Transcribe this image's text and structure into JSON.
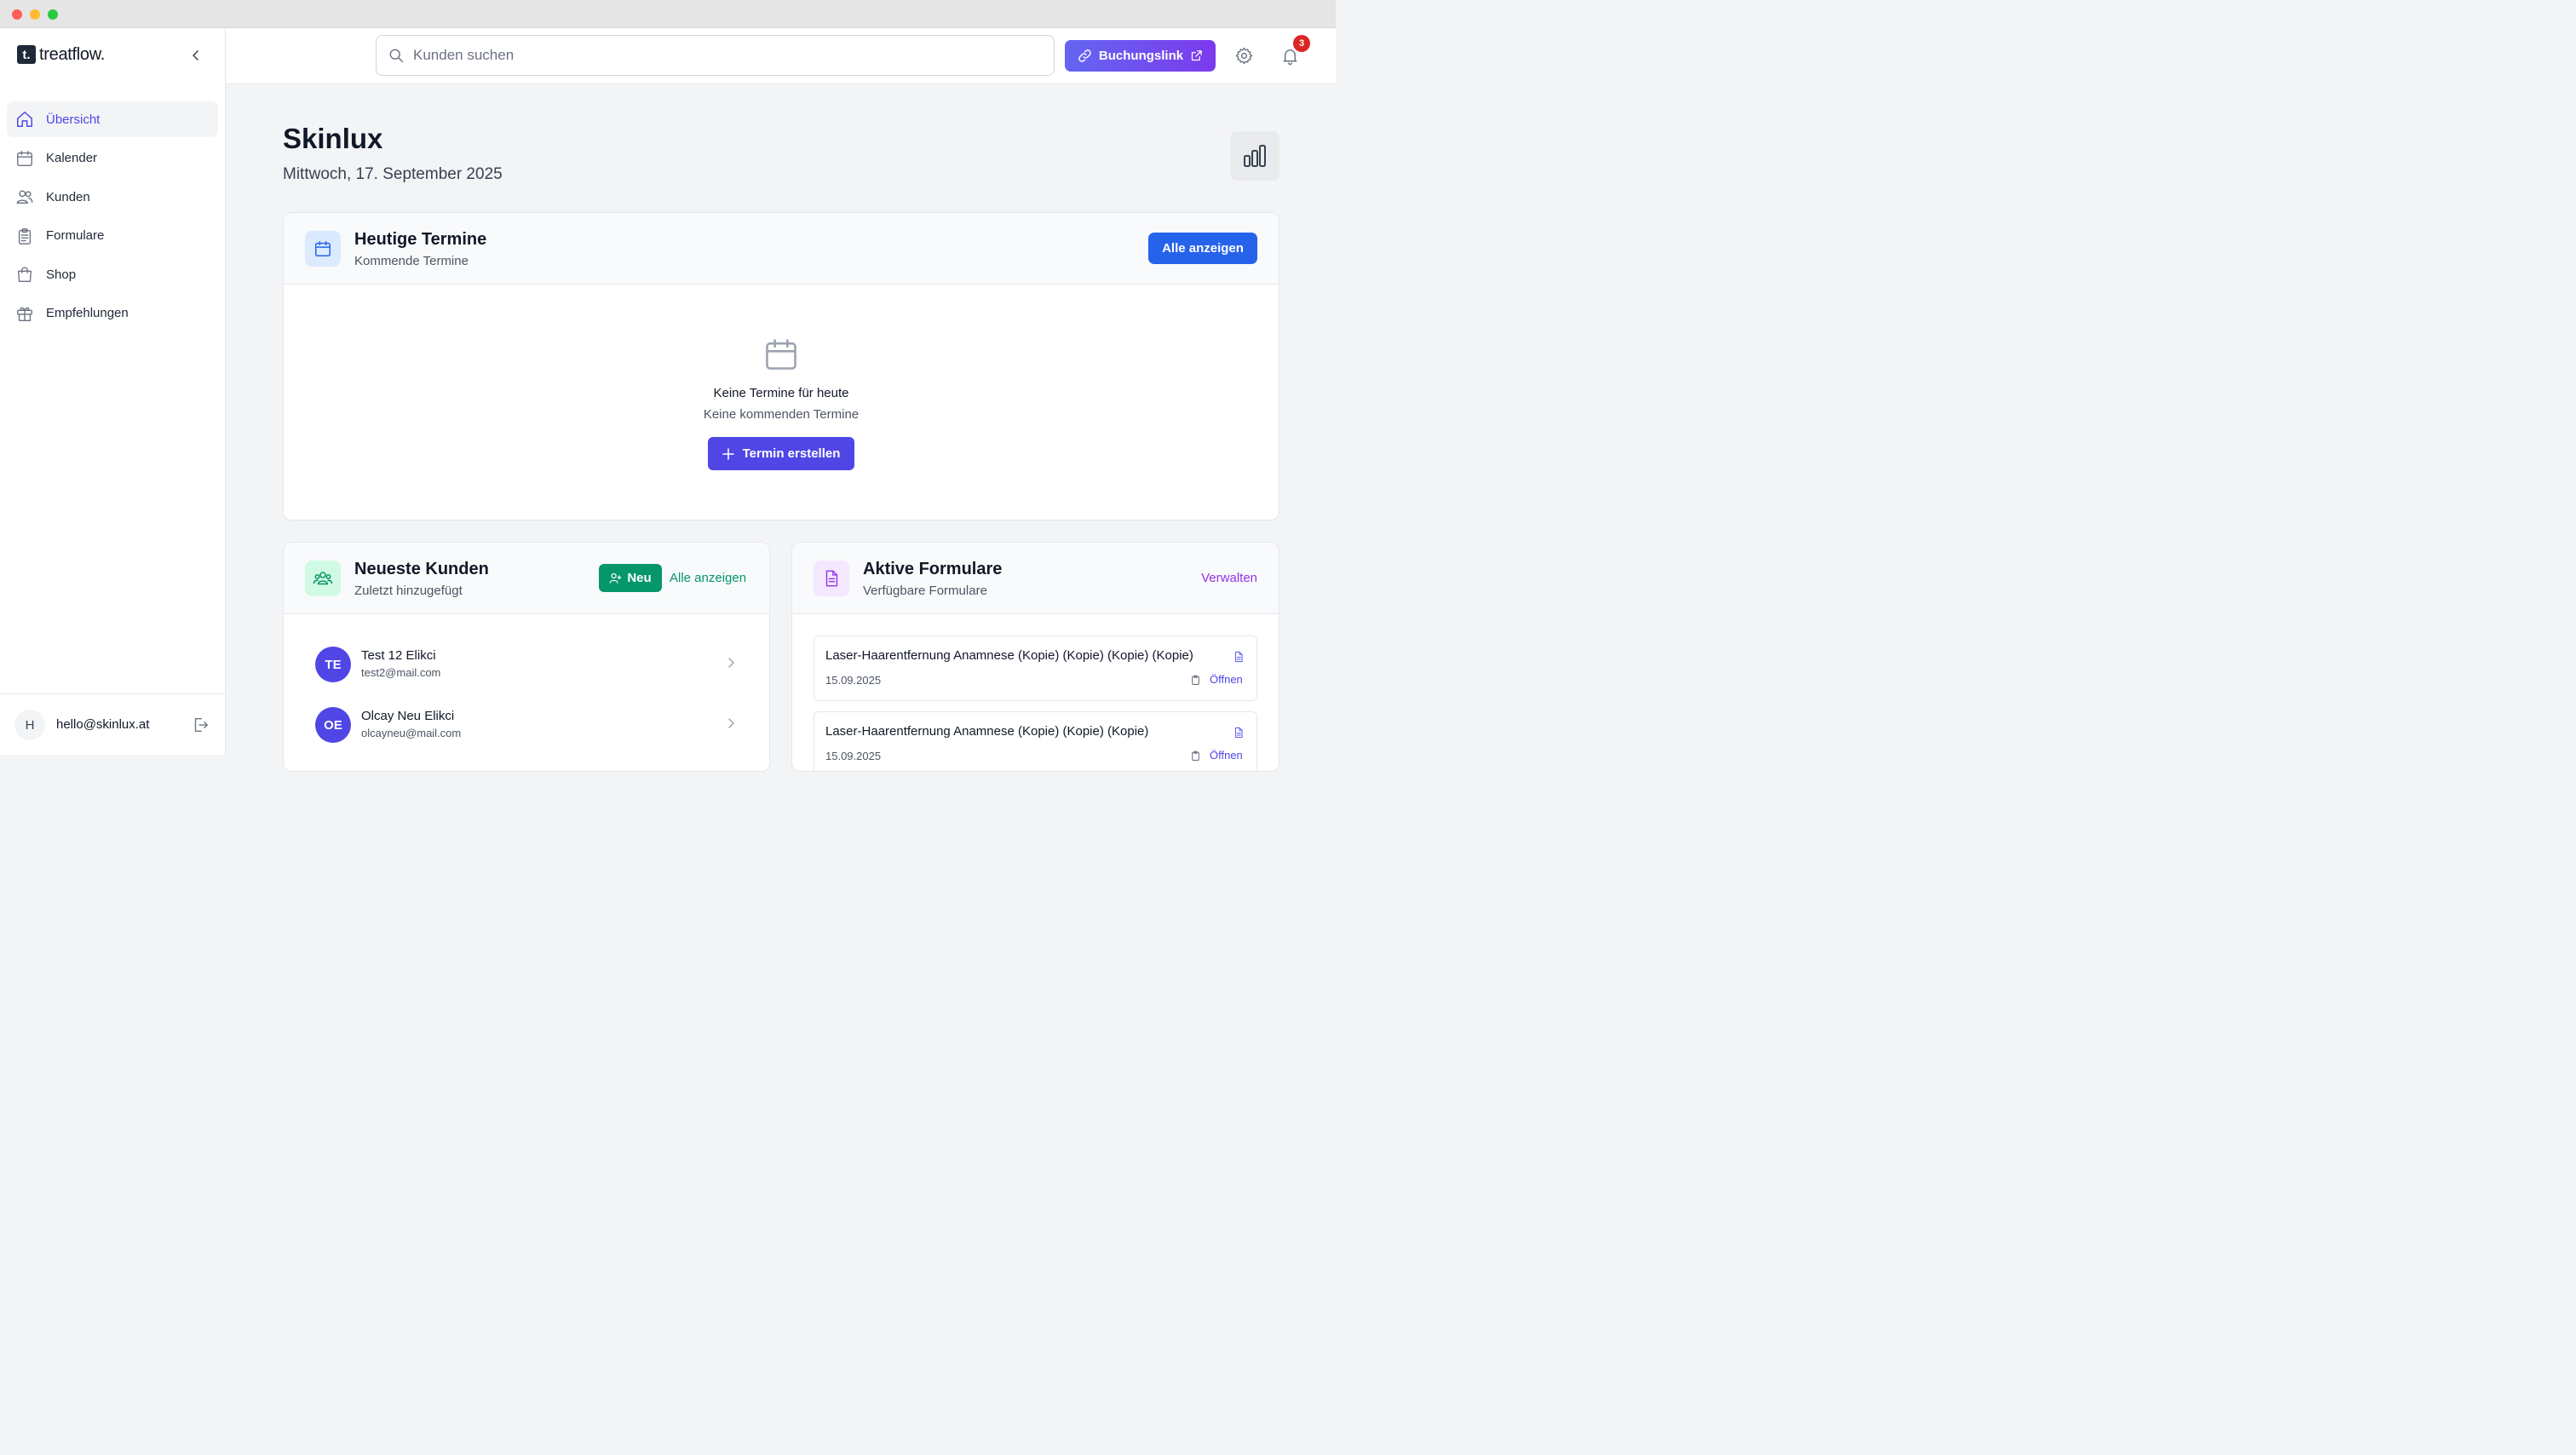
{
  "app": {
    "logo_mark": "t.",
    "logo_text": "treatflow."
  },
  "sidebar": {
    "items": [
      {
        "label": "Übersicht",
        "icon": "home-icon",
        "active": true
      },
      {
        "label": "Kalender",
        "icon": "calendar-icon",
        "active": false
      },
      {
        "label": "Kunden",
        "icon": "users-icon",
        "active": false
      },
      {
        "label": "Formulare",
        "icon": "clipboard-icon",
        "active": false
      },
      {
        "label": "Shop",
        "icon": "shopping-bag-icon",
        "active": false
      },
      {
        "label": "Empfehlungen",
        "icon": "gift-icon",
        "active": false
      }
    ],
    "user": {
      "initial": "H",
      "email": "hello@skinlux.at"
    }
  },
  "topbar": {
    "search_placeholder": "Kunden suchen",
    "booking_link_label": "Buchungslink",
    "notification_count": "3"
  },
  "main": {
    "title": "Skinlux",
    "date": "Mittwoch, 17. September 2025",
    "appointments": {
      "title": "Heutige Termine",
      "subtitle": "Kommende Termine",
      "view_all_label": "Alle anzeigen",
      "empty_title": "Keine Termine für heute",
      "empty_subtitle": "Keine kommenden Termine",
      "create_label": "Termin erstellen"
    },
    "customers": {
      "title": "Neueste Kunden",
      "subtitle": "Zuletzt hinzugefügt",
      "new_label": "Neu",
      "view_all_label": "Alle anzeigen",
      "items": [
        {
          "initials": "TE",
          "name": "Test 12 Elikci",
          "email": "test2@mail.com"
        },
        {
          "initials": "OE",
          "name": "Olcay Neu Elikci",
          "email": "olcayneu@mail.com"
        }
      ]
    },
    "forms": {
      "title": "Aktive Formulare",
      "subtitle": "Verfügbare Formulare",
      "manage_label": "Verwalten",
      "items": [
        {
          "name": "Laser-Haarentfernung Anamnese (Kopie) (Kopie) (Kopie) (Kopie)",
          "date": "15.09.2025",
          "open_label": "Öffnen"
        },
        {
          "name": "Laser-Haarentfernung Anamnese (Kopie) (Kopie) (Kopie)",
          "date": "15.09.2025",
          "open_label": "Öffnen"
        }
      ]
    }
  },
  "colors": {
    "accent": "#4f46e5",
    "primary_blue": "#2563eb",
    "green": "#059669",
    "purple": "#9333ea",
    "badge_red": "#dc2626"
  }
}
